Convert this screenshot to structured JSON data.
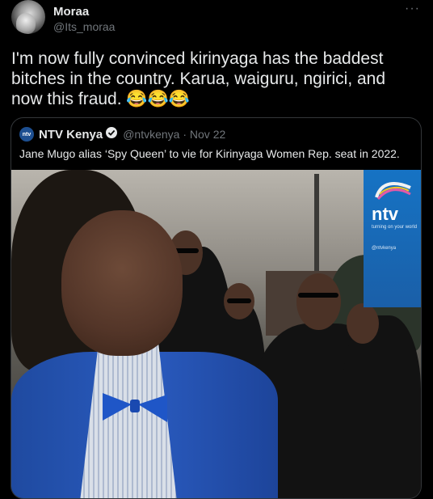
{
  "user": {
    "name": "Moraa",
    "handle": "@Its_moraa",
    "more_icon": "more-horizontal-icon"
  },
  "tweet": {
    "text": "I'm now fully convinced kirinyaga has the baddest bitches in the country. Karua, waiguru, ngirici, and now this fraud.",
    "emojis": "😂😂😂"
  },
  "quote": {
    "avatar_text": "ntv",
    "name": "NTV Kenya",
    "handle": "@ntvkenya",
    "separator": "·",
    "date": "Nov 22",
    "text": "Jane Mugo alias ‘Spy Queen’ to vie for Kirinyaga Women Rep. seat in 2022."
  },
  "photo": {
    "logo_word": "ntv",
    "logo_tagline": "turning on your world",
    "logo_social": "@ntvkenya"
  },
  "colors": {
    "background": "#000000",
    "text": "#e7e9ea",
    "secondary": "#71767b",
    "verified": "#1d9bf0",
    "ntv_blue": "#1673c4"
  }
}
